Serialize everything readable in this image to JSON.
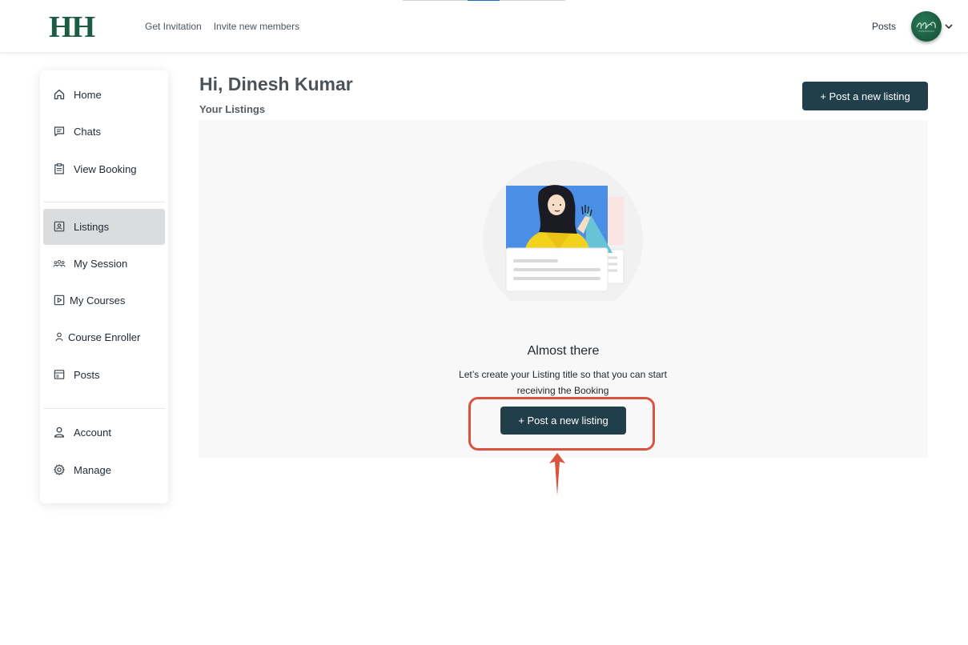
{
  "header": {
    "logo": "HH",
    "nav": [
      "Get Invitation",
      "Invite new members"
    ],
    "posts_link": "Posts"
  },
  "sidebar": {
    "items": [
      {
        "label": "Home",
        "icon": "home-icon"
      },
      {
        "label": "Chats",
        "icon": "chat-icon"
      },
      {
        "label": "View Booking",
        "icon": "clipboard-icon"
      },
      {
        "label": "Listings",
        "icon": "listing-icon",
        "active": true
      },
      {
        "label": "My Session",
        "icon": "group-icon"
      },
      {
        "label": "My Courses",
        "icon": "play-square-icon"
      },
      {
        "label": "Course Enroller",
        "icon": "user-icon"
      },
      {
        "label": "Posts",
        "icon": "posts-icon"
      },
      {
        "label": "Account",
        "icon": "account-icon"
      },
      {
        "label": "Manage",
        "icon": "gear-icon"
      }
    ]
  },
  "main": {
    "greeting": "Hi, Dinesh Kumar",
    "subtitle": "Your Listings",
    "post_button": "+ Post a new listing",
    "empty_state": {
      "title": "Almost there",
      "description": "Let’s create your Listing title so that you can start receiving the Booking",
      "button": "+ Post a new listing"
    }
  },
  "colors": {
    "brand": "#1b5c42",
    "primary_button": "#203f4b",
    "highlight": "#d9543e",
    "active_sidebar": "#dadcde"
  }
}
